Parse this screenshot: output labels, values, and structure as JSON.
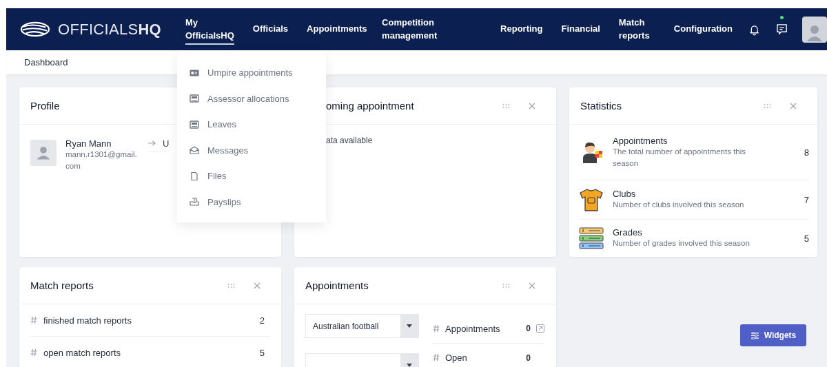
{
  "logo": "OFFICIALS**HQ**",
  "nav": [
    {
      "label": "My OfficialsHQ",
      "selected": true
    },
    {
      "label": "Officials",
      "selected": false
    },
    {
      "label": "Appointments",
      "selected": false
    },
    {
      "label": "Competition management",
      "selected": false
    },
    {
      "label": "Reporting",
      "selected": false
    },
    {
      "label": "Financial",
      "selected": false
    },
    {
      "label": "Match reports",
      "selected": false
    },
    {
      "label": "Configuration",
      "selected": false
    }
  ],
  "messages_unread": true,
  "breadcrumb": "Dashboard",
  "dropdown": [
    {
      "kind": "card",
      "label": "Umpire appointments"
    },
    {
      "kind": "paper",
      "label": "Assessor allocations"
    },
    {
      "kind": "paper",
      "label": "Leaves"
    },
    {
      "kind": "mail",
      "label": "Messages"
    },
    {
      "kind": "file",
      "label": "Files"
    },
    {
      "kind": "payslip",
      "label": "Payslips"
    }
  ],
  "profile": {
    "title": "Profile",
    "name": "Ryan Mann",
    "email": "mann.r1301@gmail.com",
    "link": "U"
  },
  "upcoming": {
    "title": "oming appointment",
    "message": "ata available"
  },
  "statistics": {
    "title": "Statistics",
    "items": [
      {
        "kind": "referee",
        "title": "Appointments",
        "description": "The total number of appointments this season",
        "count": "8"
      },
      {
        "kind": "jersey",
        "title": "Clubs",
        "description": "Number of clubs involved this season",
        "count": "7"
      },
      {
        "kind": "grades",
        "title": "Grades",
        "description": "Number of grades involved this season",
        "count": "5"
      }
    ]
  },
  "match_reports": {
    "title": "Match reports",
    "rows": [
      {
        "label": "finished match reports",
        "count": "2"
      },
      {
        "label": "open match reports",
        "count": "5"
      }
    ]
  },
  "appointments": {
    "title": "Appointments",
    "rows": [
      {
        "filter": "Australian football",
        "label": "Appointments",
        "count": "0",
        "link": true
      },
      {
        "label": "Open",
        "count": "0",
        "link": false
      }
    ]
  },
  "widgets_button": "Widgets"
}
